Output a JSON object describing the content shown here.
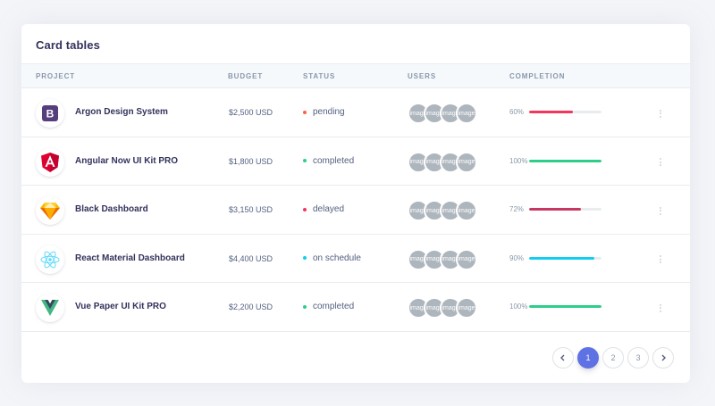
{
  "card": {
    "title": "Card tables"
  },
  "columns": [
    "Project",
    "Budget",
    "Status",
    "Users",
    "Completion"
  ],
  "rows": [
    {
      "project": "Argon Design System",
      "logo_icon": "bootstrap-icon",
      "budget": "$2,500 USD",
      "status": "pending",
      "status_color": "#fb6340",
      "avatars": [
        "image",
        "image",
        "image",
        "image"
      ],
      "completion_label": "60%",
      "completion": 0.6,
      "bar_color": "#f5365c"
    },
    {
      "project": "Angular Now UI Kit PRO",
      "logo_icon": "angular-icon",
      "budget": "$1,800 USD",
      "status": "completed",
      "status_color": "#2dce89",
      "avatars": [
        "image",
        "image",
        "image",
        "image"
      ],
      "completion_label": "100%",
      "completion": 1.0,
      "bar_color": "#2dce89"
    },
    {
      "project": "Black Dashboard",
      "logo_icon": "sketch-icon",
      "budget": "$3,150 USD",
      "status": "delayed",
      "status_color": "#f5365c",
      "avatars": [
        "image",
        "image",
        "image",
        "image"
      ],
      "completion_label": "72%",
      "completion": 0.72,
      "bar_color": "#c73761"
    },
    {
      "project": "React Material Dashboard",
      "logo_icon": "react-icon",
      "budget": "$4,400 USD",
      "status": "on schedule",
      "status_color": "#11cdef",
      "avatars": [
        "image",
        "image",
        "image",
        "image"
      ],
      "completion_label": "90%",
      "completion": 0.9,
      "bar_color": "#11cdef"
    },
    {
      "project": "Vue Paper UI Kit PRO",
      "logo_icon": "vue-icon",
      "budget": "$2,200 USD",
      "status": "completed",
      "status_color": "#2dce89",
      "avatars": [
        "image",
        "image",
        "image",
        "image"
      ],
      "completion_label": "100%",
      "completion": 1.0,
      "bar_color": "#2dce89"
    }
  ],
  "pagination": {
    "prev_icon": "chevron-left-icon",
    "pages": [
      "1",
      "2",
      "3"
    ],
    "active": "1",
    "next_icon": "chevron-right-icon"
  },
  "colors": {
    "primary": "#5e72e4",
    "text": "#32325d",
    "muted": "#8898aa"
  }
}
